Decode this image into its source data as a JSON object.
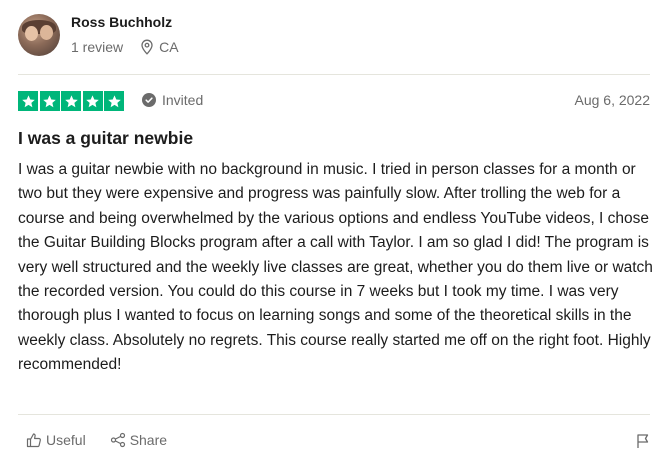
{
  "reviewer": {
    "name": "Ross Buchholz",
    "review_count": "1 review",
    "location": "CA",
    "avatar_icon": "avatar-photo"
  },
  "rating": {
    "stars": 5,
    "max_stars": 5,
    "star_color": "#00b67a"
  },
  "badge": {
    "label": "Invited",
    "icon": "check-circle-icon"
  },
  "date": "Aug 6, 2022",
  "review": {
    "title": "I was a guitar newbie",
    "body": "I was a guitar newbie with no background in music. I tried in person classes for a month or two but they were expensive and progress was painfully slow. After trolling the web for a course and being overwhelmed by the various options and endless YouTube videos, I chose the Guitar Building Blocks program after a call with Taylor. I am so glad I did! The program is very well structured and the weekly live classes are great, whether you do them live or watch the recorded version. You could do this course in 7 weeks but I took my time. I was very thorough plus I wanted to focus on learning songs and some of the theoretical skills in the weekly class. Absolutely no regrets. This course really started me off on the right foot. Highly recommended!"
  },
  "actions": {
    "useful_label": "Useful",
    "share_label": "Share",
    "flag_icon": "flag-icon"
  },
  "colors": {
    "text": "#1c1c1c",
    "muted": "#6b6b6b",
    "divider": "#e5e5dd"
  }
}
